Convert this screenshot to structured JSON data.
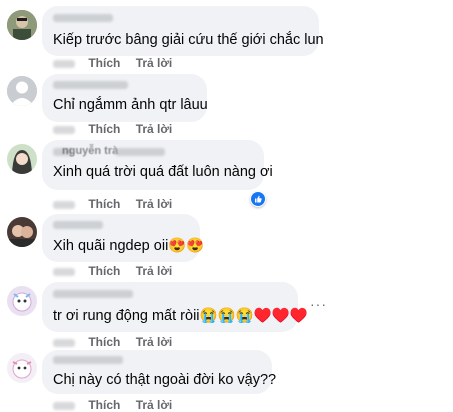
{
  "comments": [
    {
      "text": "Kiếp trước bâng giải cứu thế giới chắc lun",
      "like": "Thích",
      "reply": "Trả lời"
    },
    {
      "text": "Chỉ ngắmm ảnh qtr lâuu",
      "like": "Thích",
      "reply": "Trả lời"
    },
    {
      "name": "nguyễn trà",
      "text": "Xinh quá trời quá đất luôn nàng ơi",
      "like": "Thích",
      "reply": "Trả lời"
    },
    {
      "text": "Xih quãi ngdep oii😍😍",
      "like": "Thích",
      "reply": "Trả lời"
    },
    {
      "text": "tr ơi rung động mất ròii😭😭😭♥️♥️♥️",
      "like": "Thích",
      "reply": "Trả lời",
      "more": "···"
    },
    {
      "text": "Chị này có thật ngoài đời ko vậy??",
      "like": "Thích",
      "reply": "Trả lời"
    }
  ],
  "icons": {
    "reaction": "like-reaction-icon",
    "avatar": "user-avatar",
    "more": "more-options-icon"
  },
  "colors": {
    "bubble": "#f0f2f5",
    "meta": "#65676b",
    "like_blue": "#1877f2",
    "text": "#050505"
  }
}
